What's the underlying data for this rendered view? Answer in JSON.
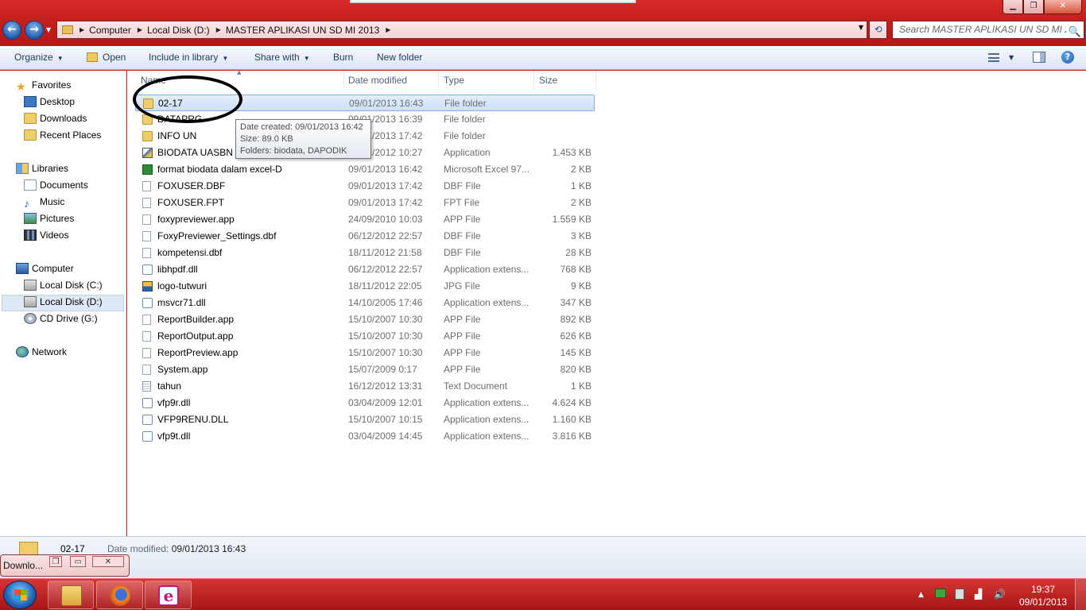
{
  "window": {
    "min_glyph": "▁",
    "max_glyph": "❐",
    "close_glyph": "✕"
  },
  "nav": {
    "back_glyph": "←",
    "forward_glyph": "→",
    "recent_glyph": "▼"
  },
  "address": {
    "breadcrumbs": [
      "Computer",
      "Local Disk (D:)",
      "MASTER APLIKASI UN SD MI 2013"
    ],
    "separator": "▶",
    "dropdown_glyph": "▼",
    "refresh_glyph": "⟲"
  },
  "search": {
    "placeholder": "Search MASTER APLIKASI UN SD MI 2...",
    "icon_glyph": "🔍"
  },
  "toolbar": {
    "organize": "Organize",
    "open": "Open",
    "include_in_library": "Include in library",
    "share_with": "Share with",
    "burn": "Burn",
    "new_folder": "New folder",
    "caret": "▼",
    "help": "?"
  },
  "sidebar": {
    "favorites": "Favorites",
    "desktop": "Desktop",
    "downloads": "Downloads",
    "recent_places": "Recent Places",
    "libraries": "Libraries",
    "documents": "Documents",
    "music": "Music",
    "pictures": "Pictures",
    "videos": "Videos",
    "computer": "Computer",
    "local_disk_c": "Local Disk (C:)",
    "local_disk_d": "Local Disk (D:)",
    "cd_drive": "CD Drive (G:)",
    "network": "Network",
    "star_glyph": "★",
    "music_glyph": "♪"
  },
  "columns": {
    "name": "Name",
    "date_modified": "Date modified",
    "type": "Type",
    "size": "Size",
    "sort_glyph": "▲"
  },
  "files": [
    {
      "name": "02-17",
      "date": "09/01/2013 16:43",
      "type": "File folder",
      "size": "",
      "icon": "folder"
    },
    {
      "name": "DATAPRG",
      "date": "09/01/2013 16:39",
      "type": "File folder",
      "size": "",
      "icon": "folder"
    },
    {
      "name": "INFO UN",
      "date": "09/01/2013 17:42",
      "type": "File folder",
      "size": "",
      "icon": "folder"
    },
    {
      "name": "BIODATA UASBN",
      "date": "09/01/2012 10:27",
      "type": "Application",
      "size": "1.453 KB",
      "icon": "app"
    },
    {
      "name": "format biodata dalam excel-D",
      "date": "09/01/2013 16:42",
      "type": "Microsoft Excel 97...",
      "size": "2 KB",
      "icon": "xls"
    },
    {
      "name": "FOXUSER.DBF",
      "date": "09/01/2013 17:42",
      "type": "DBF File",
      "size": "1 KB",
      "icon": "file"
    },
    {
      "name": "FOXUSER.FPT",
      "date": "09/01/2013 17:42",
      "type": "FPT File",
      "size": "2 KB",
      "icon": "file"
    },
    {
      "name": "foxypreviewer.app",
      "date": "24/09/2010 10:03",
      "type": "APP File",
      "size": "1.559 KB",
      "icon": "file"
    },
    {
      "name": "FoxyPreviewer_Settings.dbf",
      "date": "06/12/2012 22:57",
      "type": "DBF File",
      "size": "3 KB",
      "icon": "file"
    },
    {
      "name": "kompetensi.dbf",
      "date": "18/11/2012 21:58",
      "type": "DBF File",
      "size": "28 KB",
      "icon": "file"
    },
    {
      "name": "libhpdf.dll",
      "date": "06/12/2012 22:57",
      "type": "Application extens...",
      "size": "768 KB",
      "icon": "dll"
    },
    {
      "name": "logo-tutwuri",
      "date": "18/11/2012 22:05",
      "type": "JPG File",
      "size": "9 KB",
      "icon": "jpg"
    },
    {
      "name": "msvcr71.dll",
      "date": "14/10/2005 17:46",
      "type": "Application extens...",
      "size": "347 KB",
      "icon": "dll"
    },
    {
      "name": "ReportBuilder.app",
      "date": "15/10/2007 10:30",
      "type": "APP File",
      "size": "892 KB",
      "icon": "file"
    },
    {
      "name": "ReportOutput.app",
      "date": "15/10/2007 10:30",
      "type": "APP File",
      "size": "626 KB",
      "icon": "file"
    },
    {
      "name": "ReportPreview.app",
      "date": "15/10/2007 10:30",
      "type": "APP File",
      "size": "145 KB",
      "icon": "file"
    },
    {
      "name": "System.app",
      "date": "15/07/2009 0:17",
      "type": "APP File",
      "size": "820 KB",
      "icon": "file"
    },
    {
      "name": "tahun",
      "date": "16/12/2012 13:31",
      "type": "Text Document",
      "size": "1 KB",
      "icon": "txt"
    },
    {
      "name": "vfp9r.dll",
      "date": "03/04/2009 12:01",
      "type": "Application extens...",
      "size": "4.624 KB",
      "icon": "dll"
    },
    {
      "name": "VFP9RENU.DLL",
      "date": "15/10/2007 10:15",
      "type": "Application extens...",
      "size": "1.160 KB",
      "icon": "dll"
    },
    {
      "name": "vfp9t.dll",
      "date": "03/04/2009 14:45",
      "type": "Application extens...",
      "size": "3.816 KB",
      "icon": "dll"
    }
  ],
  "selected_index": 0,
  "tooltip": {
    "line1": "Date created: 09/01/2013 16:42",
    "line2": "Size: 89.0 KB",
    "line3": "Folders: biodata, DAPODIK"
  },
  "details": {
    "name": "02-17",
    "label": "Date modified:",
    "value": "09/01/2013 16:43"
  },
  "miniwin": {
    "title": "Downlo...",
    "restore_glyph": "❐",
    "max_glyph": "▭",
    "close_glyph": "✕"
  },
  "taskbar": {
    "app3_glyph": "e",
    "time": "19:37",
    "date": "09/01/2013",
    "tray_up_glyph": "▲",
    "volume_glyph": "🔊",
    "signal_glyph": "▟"
  }
}
